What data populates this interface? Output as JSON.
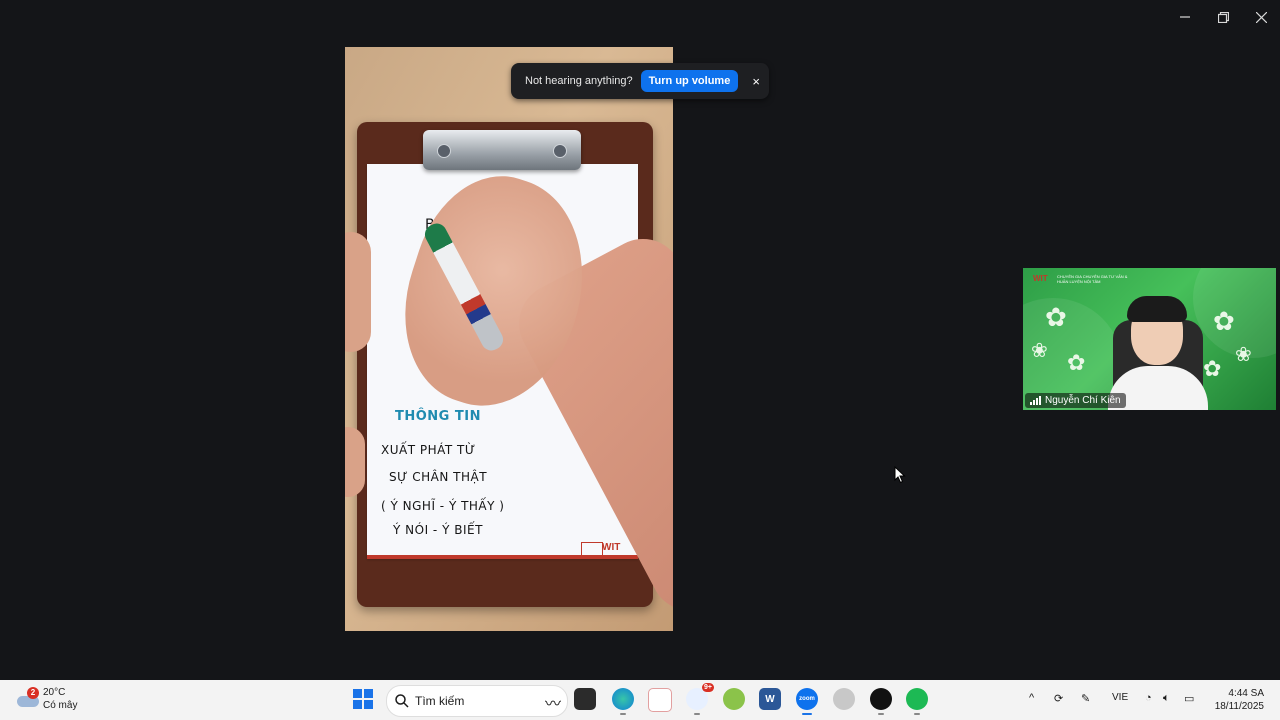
{
  "window": {
    "minimize_icon": "minimize-icon",
    "restore_icon": "restore-icon",
    "close_icon": "close-icon"
  },
  "toast": {
    "message": "Not hearing anything?",
    "action": "Turn up volume",
    "close": "×"
  },
  "shared_screen": {
    "handwriting": {
      "scribble": "B",
      "title": "THÔNG TIN",
      "line1": "XUẤT PHÁT TỪ",
      "line2": "SỰ CHÂN THẬT",
      "line3": "( Ý NGHĨ - Ý THẤY )",
      "line4": "Ý NÓI - Ý BIẾT"
    },
    "logo": "WIT"
  },
  "participant": {
    "name": "Nguyễn Chí Kiên",
    "brand": "WIT",
    "tagline": "CHUYÊN GIA CHUYÊN GIA TƯ VẤN & HUẤN LUYỆN NỘI TÂM"
  },
  "taskbar": {
    "weather": {
      "badge": "2",
      "temp": "20°C",
      "condition": "Có mây"
    },
    "search_placeholder": "Tìm kiếm",
    "zoom_badge": "9+",
    "language": "VIE",
    "time": "4:44 SA",
    "date": "18/11/2025"
  },
  "colors": {
    "zoom_blue": "#0e72ed",
    "tile_green": "#46c05a",
    "taskbar": "#f3f3f3",
    "background": "#141518"
  }
}
